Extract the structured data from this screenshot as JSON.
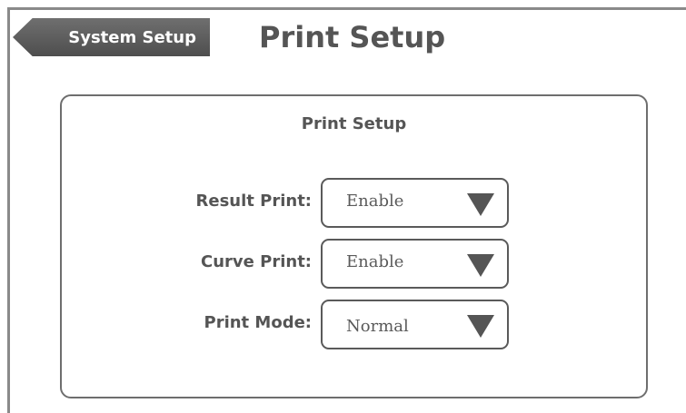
{
  "header": {
    "back_label": "System Setup",
    "title": "Print Setup"
  },
  "panel": {
    "title": "Print Setup",
    "fields": [
      {
        "label": "Result Print:",
        "value": "Enable",
        "icon": "dropdown-arrow-icon"
      },
      {
        "label": "Curve Print:",
        "value": "Enable",
        "icon": "dropdown-arrow-icon"
      },
      {
        "label": "Print Mode:",
        "value": "Normal",
        "icon": "dropdown-arrow-icon"
      }
    ]
  }
}
